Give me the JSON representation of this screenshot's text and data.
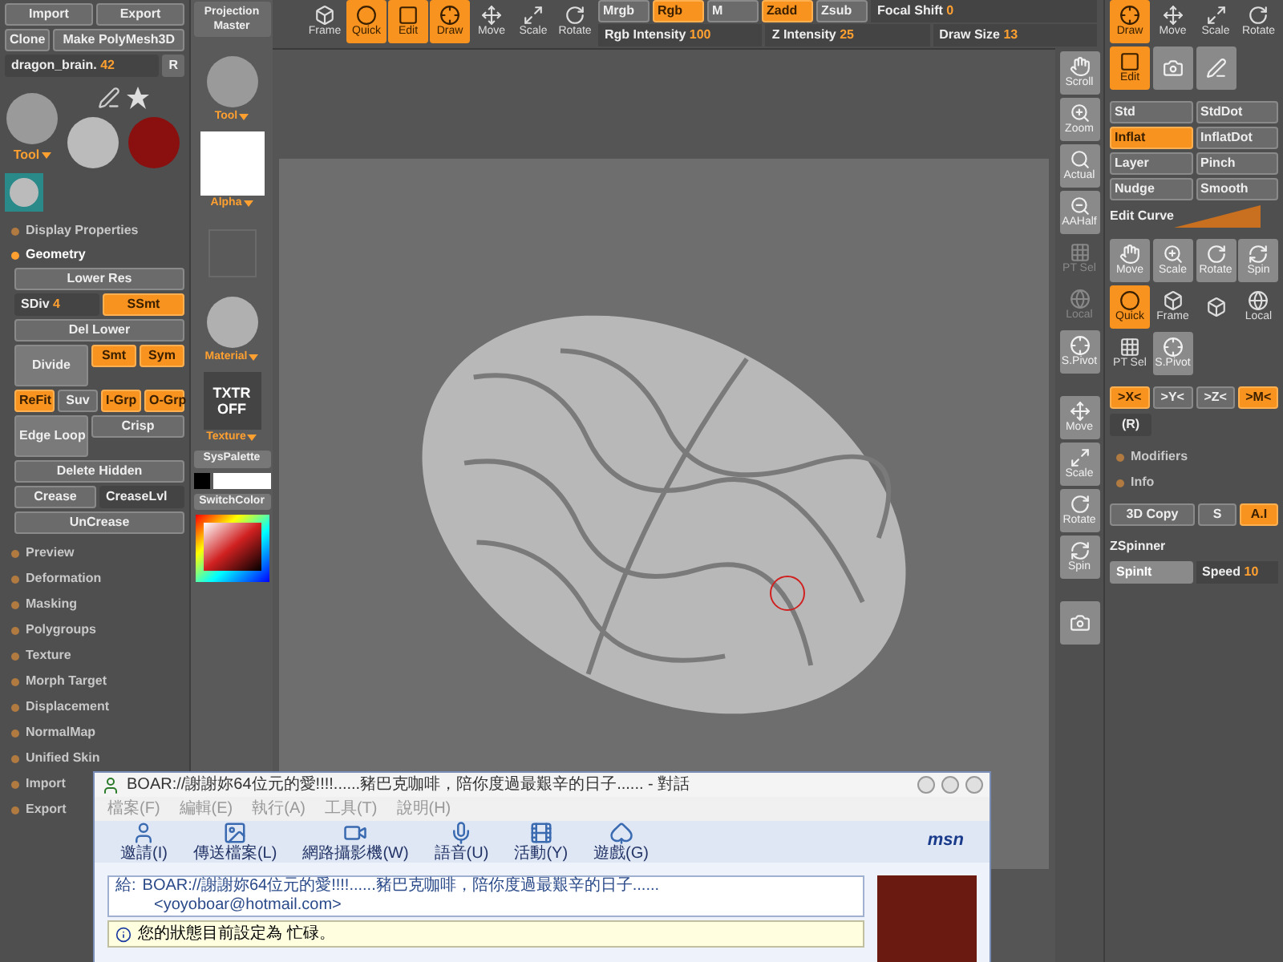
{
  "left_panel": {
    "file_buttons": [
      {
        "label": "Import"
      },
      {
        "label": "Export"
      },
      {
        "label": "Clone"
      },
      {
        "label": "Make PolyMesh3D"
      }
    ],
    "tool_name": {
      "value": "dragon_brain.",
      "number": "42"
    },
    "reset_button": "R",
    "tool_label": "Tool",
    "sections": [
      {
        "label": "Display Properties",
        "expanded": false
      },
      {
        "label": "Geometry",
        "expanded": true
      }
    ],
    "geometry_rows": [
      [
        {
          "kind": "button",
          "label": "Lower Res",
          "on": false
        }
      ],
      [
        {
          "kind": "slider",
          "label": "SDiv",
          "value": "4"
        },
        {
          "kind": "button",
          "label": "SSmt",
          "on": true
        }
      ],
      [
        {
          "kind": "button",
          "label": "Del Lower",
          "on": false
        }
      ],
      [
        {
          "kind": "big",
          "label": "Divide",
          "on": false
        },
        {
          "kind": "button",
          "label": "Smt",
          "on": true
        },
        {
          "kind": "button",
          "label": "Sym",
          "on": true
        }
      ],
      [
        {
          "kind": "button",
          "label": "ReFit",
          "on": true
        },
        {
          "kind": "button",
          "label": "Suv",
          "on": false
        },
        {
          "kind": "button",
          "label": "I-Grp",
          "on": true
        },
        {
          "kind": "button",
          "label": "O-Grp",
          "on": true
        }
      ],
      [
        {
          "kind": "big",
          "label": "Edge Loop",
          "on": false
        },
        {
          "kind": "button",
          "label": "Crisp",
          "on": false
        }
      ],
      [
        {
          "kind": "button",
          "label": "Delete Hidden",
          "on": false
        }
      ],
      [
        {
          "kind": "button",
          "label": "Crease",
          "on": false
        },
        {
          "kind": "slider",
          "label": "CreaseLvl"
        }
      ],
      [
        {
          "kind": "button",
          "label": "UnCrease",
          "on": false
        }
      ]
    ],
    "menu": [
      {
        "label": "Preview"
      },
      {
        "label": "Deformation"
      },
      {
        "label": "Masking"
      },
      {
        "label": "Polygroups"
      },
      {
        "label": "Texture"
      },
      {
        "label": "Morph Target"
      },
      {
        "label": "Displacement"
      },
      {
        "label": "NormalMap"
      },
      {
        "label": "Unified Skin"
      },
      {
        "label": "Import"
      },
      {
        "label": "Export"
      }
    ]
  },
  "tool_column": {
    "projection_master": "Projection Master",
    "palettes": [
      {
        "kind": "tool",
        "label": "Tool"
      },
      {
        "kind": "alpha",
        "label": "Alpha"
      },
      {
        "kind": "stroke"
      },
      {
        "kind": "material",
        "label": "Material"
      },
      {
        "kind": "texture",
        "label": "Texture",
        "button": "TXTR OFF"
      }
    ],
    "sys_palette": "SysPalette",
    "switch_color": "SwitchColor"
  },
  "top_bar": {
    "view_tools": [
      {
        "kind": "frame",
        "label": "Frame",
        "on": false
      },
      {
        "kind": "quick",
        "label": "Quick",
        "on": true
      },
      {
        "kind": "edit",
        "label": "Edit",
        "on": true
      },
      {
        "kind": "draw",
        "label": "Draw",
        "on": true
      },
      {
        "kind": "move",
        "label": "Move",
        "on": false
      },
      {
        "kind": "scale",
        "label": "Scale",
        "on": false
      },
      {
        "kind": "rotate",
        "label": "Rotate",
        "on": false
      }
    ],
    "channels": [
      {
        "label": "Mrgb",
        "on": false
      },
      {
        "label": "Rgb",
        "on": true
      },
      {
        "label": "M",
        "on": false
      },
      {
        "label": "Zadd",
        "on": true
      },
      {
        "label": "Zsub",
        "on": false
      }
    ],
    "sliders": [
      {
        "label": "Focal Shift",
        "value": "0"
      },
      {
        "label": "Rgb Intensity",
        "value": "100"
      },
      {
        "label": "Z Intensity",
        "value": "25"
      },
      {
        "label": "Draw Size",
        "value": "13"
      }
    ]
  },
  "nav_tools": [
    {
      "kind": "hand",
      "label": "Scroll",
      "disabled": false
    },
    {
      "kind": "zoom",
      "label": "Zoom",
      "disabled": false
    },
    {
      "kind": "actual",
      "label": "Actual",
      "disabled": false
    },
    {
      "kind": "aahalf",
      "label": "AAHalf",
      "disabled": false
    },
    {
      "kind": "ptsel",
      "label": "PT Sel",
      "disabled": true
    },
    {
      "kind": "local",
      "label": "Local",
      "disabled": true
    },
    {
      "kind": "spivot",
      "label": "S.Pivot",
      "disabled": false
    },
    {
      "kind": "move",
      "label": "Move",
      "disabled": false
    },
    {
      "kind": "scale",
      "label": "Scale",
      "disabled": false
    },
    {
      "kind": "rotate",
      "label": "Rotate",
      "disabled": false
    },
    {
      "kind": "spin",
      "label": "Spin",
      "disabled": false
    },
    {
      "kind": "camera",
      "disabled": false
    }
  ],
  "right_panel": {
    "edit_tools": [
      {
        "kind": "draw",
        "label": "Draw",
        "on": true
      },
      {
        "kind": "move",
        "label": "Move",
        "on": false
      },
      {
        "kind": "scale",
        "label": "Scale",
        "on": false
      },
      {
        "kind": "rotate",
        "label": "Rotate",
        "on": false
      },
      {
        "kind": "edit",
        "label": "Edit",
        "on": true
      },
      {
        "kind": "camera",
        "on": false
      },
      {
        "kind": "mplus",
        "on": false
      }
    ],
    "brushes": [
      {
        "label": "Std",
        "on": false
      },
      {
        "label": "StdDot",
        "on": false
      },
      {
        "label": "Inflat",
        "on": true
      },
      {
        "label": "InflatDot",
        "on": false
      },
      {
        "label": "Layer",
        "on": false
      },
      {
        "label": "Pinch",
        "on": false
      },
      {
        "label": "Nudge",
        "on": false
      },
      {
        "label": "Smooth",
        "on": false
      }
    ],
    "edit_curve": "Edit Curve",
    "transform_tools": [
      {
        "kind": "hand",
        "label": "Move",
        "on": false
      },
      {
        "kind": "zoom",
        "label": "Scale",
        "on": false
      },
      {
        "kind": "rotate",
        "label": "Rotate",
        "on": false
      },
      {
        "kind": "spin",
        "label": "Spin",
        "on": false
      },
      {
        "kind": "quick",
        "label": "Quick",
        "on": true
      },
      {
        "kind": "frame",
        "label": "Frame",
        "on": false
      },
      {
        "kind": "frame",
        "on": false
      },
      {
        "kind": "local",
        "label": "Local",
        "on": false
      },
      {
        "kind": "ptsel",
        "label": "PT Sel",
        "on": false
      },
      {
        "kind": "spivot",
        "label": "S.Pivot",
        "on": false
      }
    ],
    "axes": [
      {
        "label": ">X<",
        "on": true
      },
      {
        "label": ">Y<",
        "on": false
      },
      {
        "label": ">Z<",
        "on": false
      },
      {
        "label": ">M<",
        "on": true
      }
    ],
    "r_button": "(R)",
    "sections": [
      {
        "label": "Modifiers",
        "expanded": false
      },
      {
        "label": "Info",
        "expanded": false
      }
    ],
    "copy_buttons": [
      {
        "label": "3D Copy",
        "on": false
      },
      {
        "label": "S",
        "on": false
      },
      {
        "label": "A.I",
        "on": true
      }
    ],
    "zspinner": {
      "title": "ZSpinner",
      "button": "SpinIt",
      "slider": {
        "label": "Speed",
        "value": "10"
      }
    }
  },
  "chat_window": {
    "title": "BOAR://謝謝妳64位元的愛!!!!......豬巴克咖啡，陪你度過最艱辛的日子...... - 對話",
    "menu": [
      "檔案(F)",
      "編輯(E)",
      "執行(A)",
      "工具(T)",
      "說明(H)"
    ],
    "toolbar": [
      {
        "kind": "person",
        "label": "邀請(I)"
      },
      {
        "kind": "image",
        "label": "傳送檔案(L)"
      },
      {
        "kind": "webcam",
        "label": "網路攝影機(W)"
      },
      {
        "kind": "mic",
        "label": "語音(U)"
      },
      {
        "kind": "activity",
        "label": "活動(Y)"
      },
      {
        "kind": "cards",
        "label": "遊戲(G)"
      }
    ],
    "brand": "msn",
    "to_label": "給:",
    "to_name": "BOAR://謝謝妳64位元的愛!!!!......豬巴克咖啡，陪你度過最艱辛的日子......",
    "to_email": "<yoyoboar@hotmail.com>",
    "status": "您的狀態目前設定為 忙碌。"
  }
}
